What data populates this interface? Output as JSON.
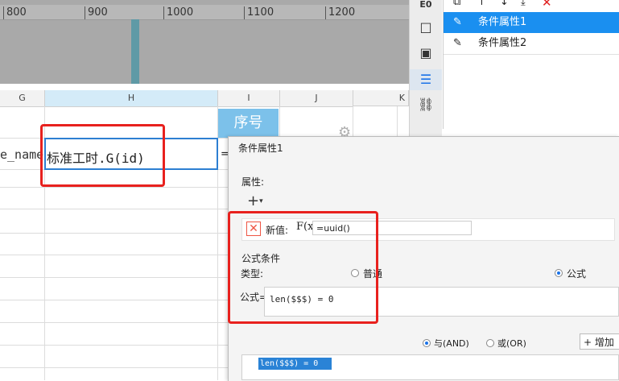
{
  "ruler": {
    "ticks": [
      "800",
      "900",
      "1000",
      "1100",
      "1200"
    ]
  },
  "toolbar_top": {
    "icons": [
      "copy-icon",
      "arrow-up-icon",
      "arrow-down-icon",
      "move-bottom-icon",
      "delete-icon"
    ]
  },
  "vtoolbar": {
    "icons": [
      "data-icon",
      "square-icon",
      "dropdown-icon",
      "condition-icon",
      "link-icon"
    ]
  },
  "conditions": {
    "items": [
      {
        "label": "条件属性1",
        "selected": true
      },
      {
        "label": "条件属性2",
        "selected": false
      }
    ]
  },
  "grid": {
    "columns": [
      "G",
      "H",
      "I",
      "J",
      "K"
    ],
    "header_cell": "序号",
    "name_cell": "e_name",
    "formula_cell": "标准工时.G(id)",
    "eq_cell": "="
  },
  "dialog": {
    "title": "条件属性1",
    "attr_label": "属性:",
    "plus": "+",
    "newval_label": "新值:",
    "fx": "F(x)",
    "newval_value": "=uuid()",
    "cond_title": "公式条件",
    "type_label": "类型:",
    "radio_normal": "普通",
    "radio_formula": "公式",
    "formula_label": "公式=",
    "formula_value": "len($$$) = 0",
    "and_label": "与(AND)",
    "or_label": "或(OR)",
    "add_label": "增加",
    "list_item": "len($$$) = 0"
  },
  "colors": {
    "selection": "#1a8ff0",
    "highlight": "#e8211e",
    "header": "#7cc1ea"
  }
}
